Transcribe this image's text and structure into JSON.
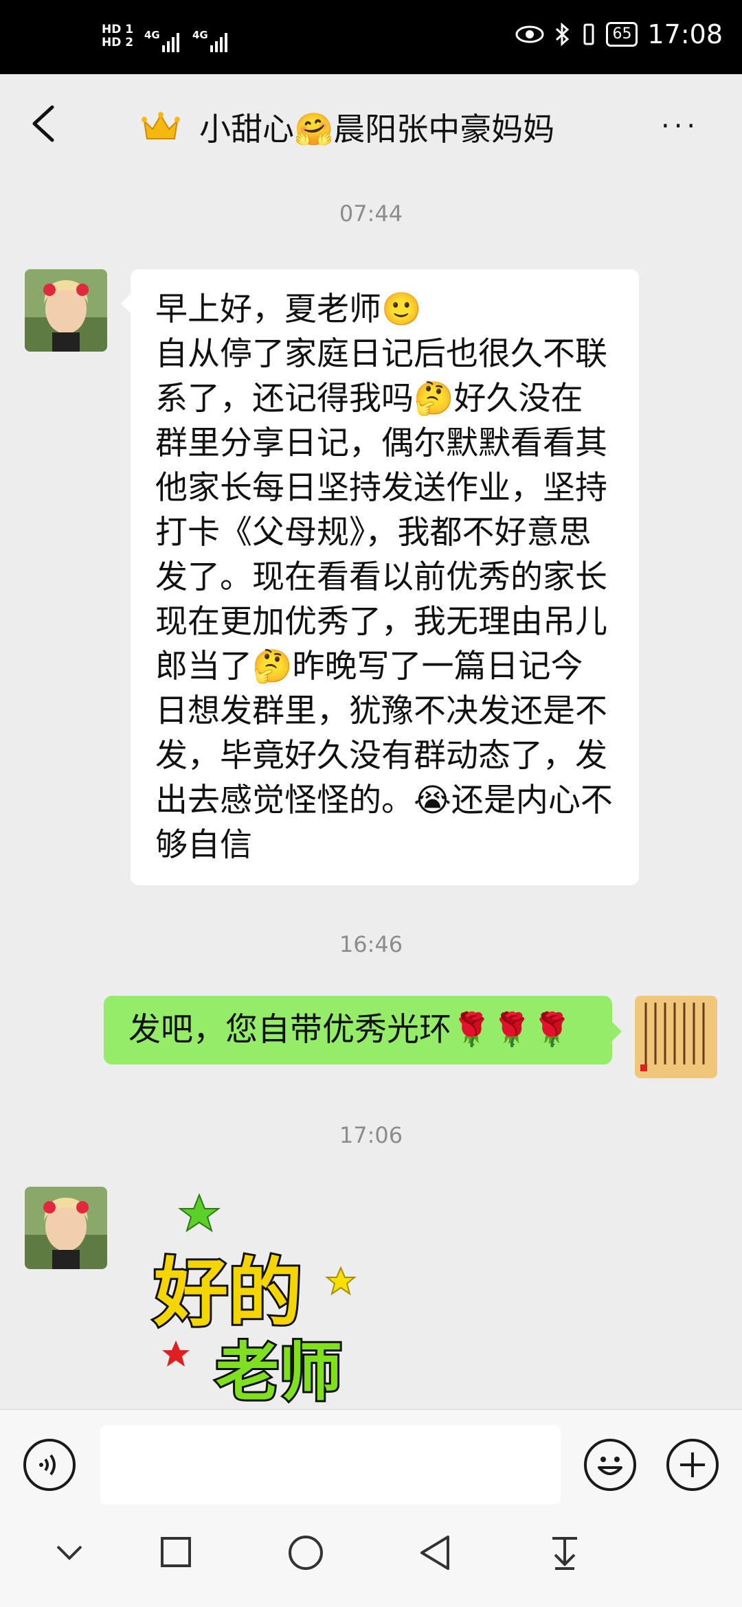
{
  "status_bar": {
    "hd1": "HD 1",
    "hd2": "HD 2",
    "net1": "4G",
    "net2": "4G",
    "battery": "65",
    "time": "17:08"
  },
  "header": {
    "title": "小甜心🤗晨阳张中豪妈妈",
    "crown_icon": "crown-icon",
    "more_label": "···"
  },
  "messages": [
    {
      "type": "time",
      "text": "07:44"
    },
    {
      "type": "received",
      "text": "早上好，夏老师🙂\n自从停了家庭日记后也很久不联系了，还记得我吗🤔好久没在群里分享日记，偶尔默默看看其他家长每日坚持发送作业，坚持打卡《父母规》，我都不好意思发了。现在看看以前优秀的家长现在更加优秀了，我无理由吊儿郎当了🤔昨晚写了一篇日记今日想发群里，犹豫不决发还是不发，毕竟好久没有群动态了，发出去感觉怪怪的。😭还是内心不够自信"
    },
    {
      "type": "time",
      "text": "16:46"
    },
    {
      "type": "sent",
      "text": "发吧，您自带优秀光环🌹🌹🌹"
    },
    {
      "type": "time",
      "text": "17:06"
    },
    {
      "type": "sticker",
      "line1": "好的",
      "line2": "老师"
    }
  ],
  "colors": {
    "background": "#ededed",
    "sent_bubble": "#95ec69",
    "received_bubble": "#ffffff"
  }
}
